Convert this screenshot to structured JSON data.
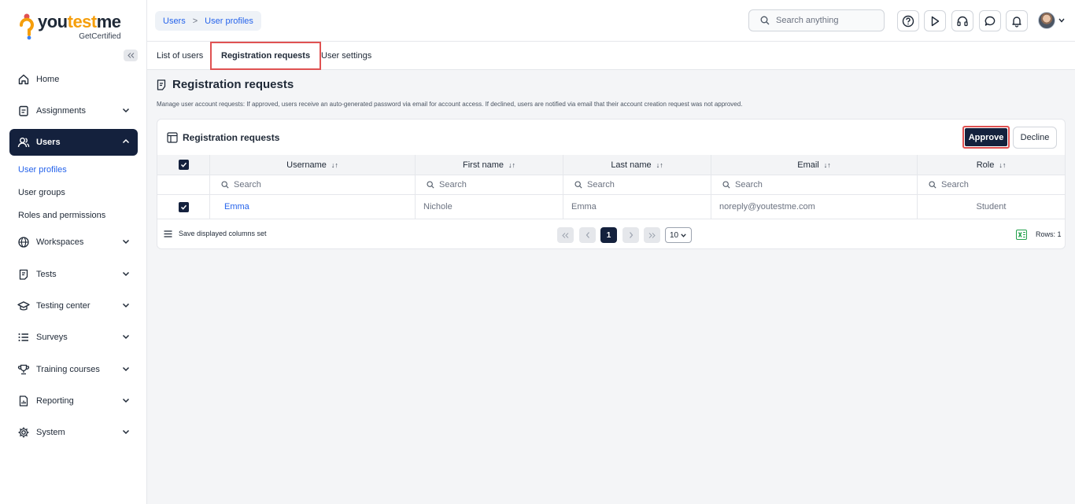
{
  "brand": {
    "name_part1": "you",
    "name_accent": "test",
    "name_part2": "me",
    "tagline": "GetCertified"
  },
  "sidebar": {
    "items": [
      {
        "label": "Home",
        "icon": "home-icon"
      },
      {
        "label": "Assignments",
        "icon": "clipboard-icon"
      },
      {
        "label": "Users",
        "icon": "users-icon"
      },
      {
        "label": "Workspaces",
        "icon": "globe-icon"
      },
      {
        "label": "Tests",
        "icon": "test-icon"
      },
      {
        "label": "Testing center",
        "icon": "graduation-icon"
      },
      {
        "label": "Surveys",
        "icon": "list-icon"
      },
      {
        "label": "Training courses",
        "icon": "trophy-icon"
      },
      {
        "label": "Reporting",
        "icon": "report-icon"
      },
      {
        "label": "System",
        "icon": "gear-icon"
      }
    ],
    "users_sub": [
      "User profiles",
      "User groups",
      "Roles and permissions"
    ]
  },
  "header": {
    "breadcrumb": [
      "Users",
      "User profiles"
    ],
    "breadcrumb_sep": ">",
    "search_placeholder": "Search anything"
  },
  "tabs": [
    "List of users",
    "Registration requests",
    "User settings"
  ],
  "page": {
    "title": "Registration requests",
    "description": "Manage user account requests: If approved, users receive an auto-generated password via email for account access. If declined, users are notified via email that their account creation request was not approved."
  },
  "card": {
    "title": "Registration requests",
    "approve_label": "Approve",
    "decline_label": "Decline"
  },
  "table": {
    "columns": [
      "Username",
      "First name",
      "Last name",
      "Email",
      "Role"
    ],
    "sort_glyph": "↓↑",
    "filter_placeholder": "Search",
    "rows": [
      {
        "username": "Emma",
        "first_name": "Nichole",
        "last_name": "Emma",
        "email": "noreply@youtestme.com",
        "role": "Student",
        "selected": true
      }
    ]
  },
  "footer": {
    "save_columns_label": "Save displayed columns set",
    "current_page": "1",
    "per_page": "10",
    "rows_label": "Rows: 1"
  },
  "colors": {
    "primary": "#14213d",
    "link": "#2563eb",
    "highlight": "#e05252",
    "accent": "#f59e0b"
  }
}
